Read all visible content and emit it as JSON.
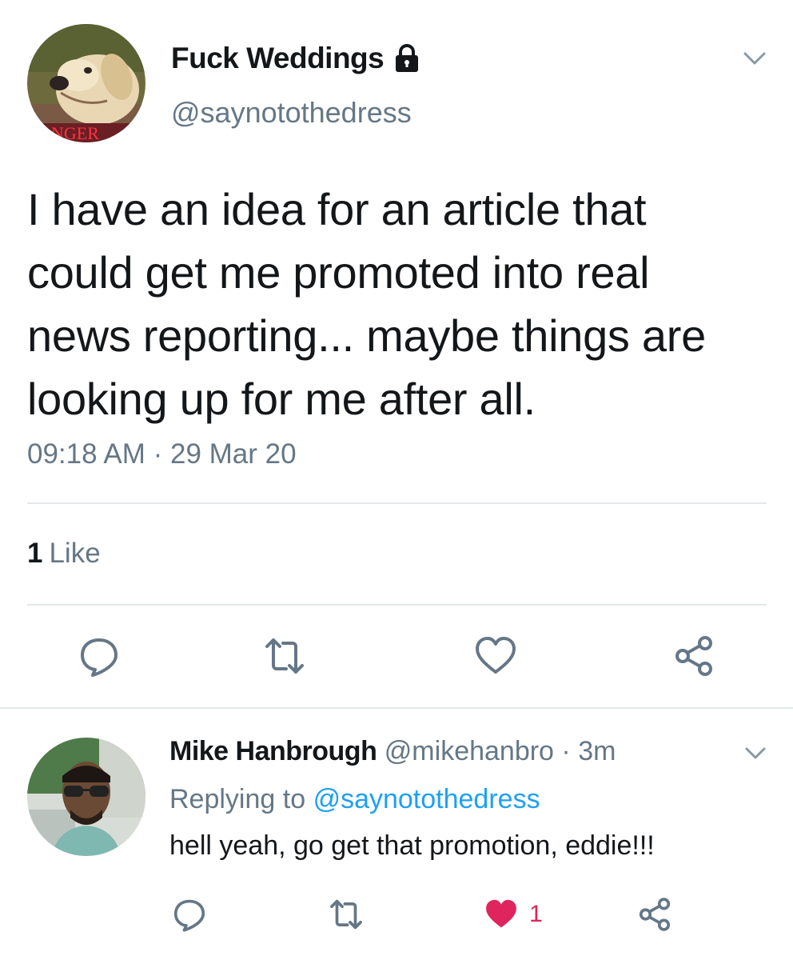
{
  "main_tweet": {
    "author_name": "Fuck Weddings",
    "author_handle": "@saynotothedress",
    "avatar_caption": "NGER",
    "text": "I have an idea for an article that\ncould get me promoted into real\nnews reporting... maybe things are\nlooking up for me after all.",
    "timestamp": "09:18 AM · 29 Mar 20",
    "likes_count": "1",
    "likes_label": "Like",
    "icons": {
      "reply": "reply-icon",
      "retweet": "retweet-icon",
      "like": "heart-outline-icon",
      "share": "share-icon",
      "lock": "lock-icon",
      "menu": "chevron-down-icon"
    }
  },
  "reply": {
    "author_name": "Mike Hanbrough",
    "author_handle": "@mikehanbro",
    "separator": "·",
    "time_ago": "3m",
    "replying_label": "Replying to",
    "replying_handle": "@saynotothedress",
    "text": "hell yeah, go get that promotion, eddie!!!",
    "like_count": "1",
    "liked": true
  },
  "colors": {
    "text_primary": "#14171a",
    "text_secondary": "#657786",
    "link": "#1da1f2",
    "like_active": "#e0245e",
    "divider": "#e1e8ed"
  }
}
